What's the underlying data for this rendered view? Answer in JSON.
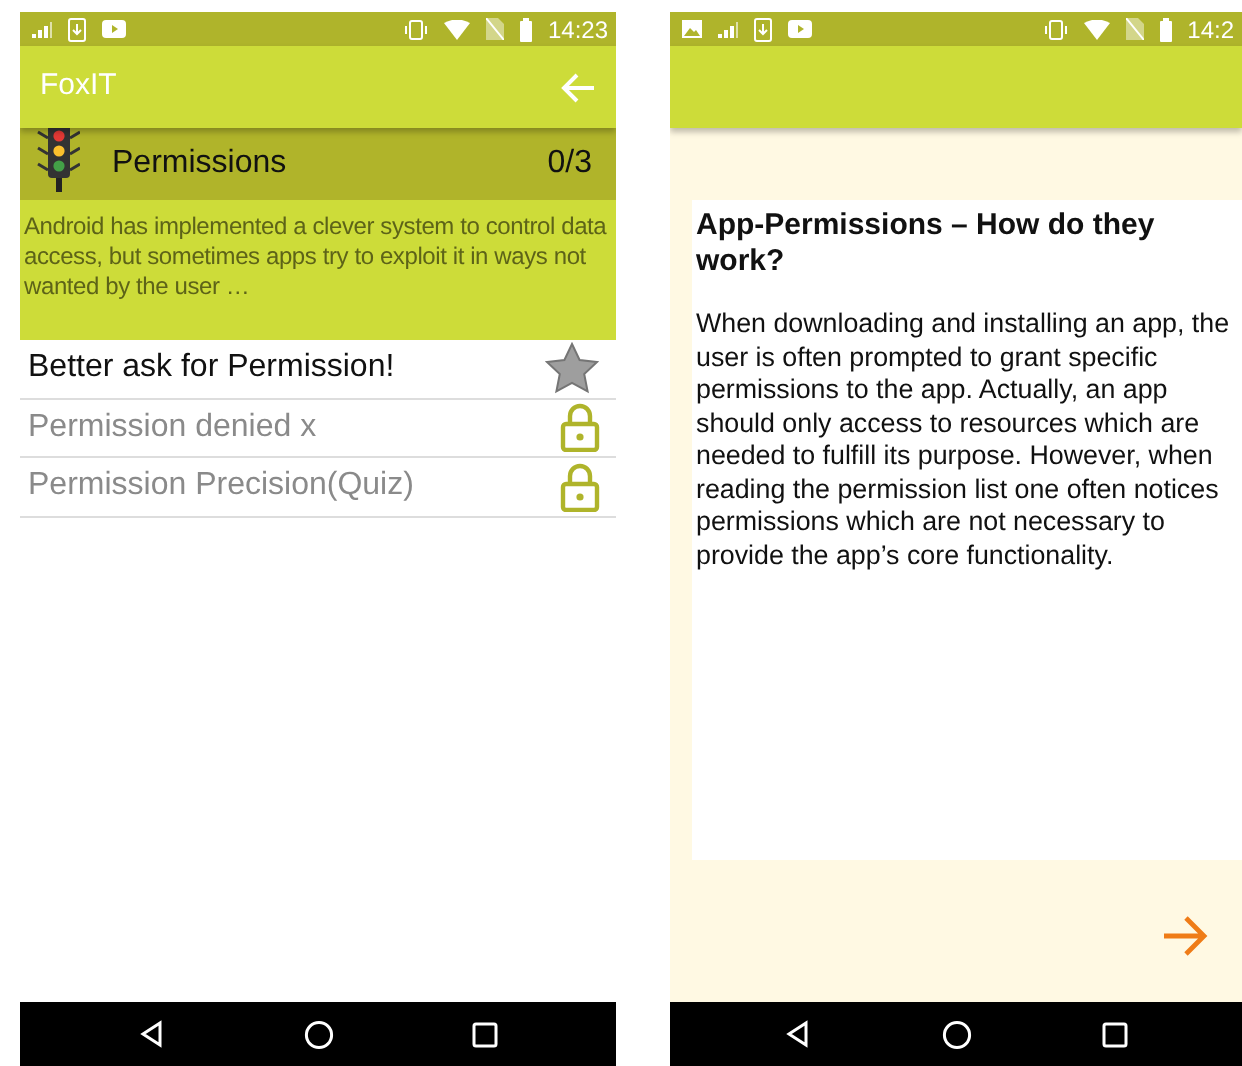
{
  "left_screen": {
    "status_bar": {
      "notifications": [
        {
          "kind": "signal"
        },
        {
          "kind": "download"
        },
        {
          "kind": "video"
        }
      ],
      "system": [
        {
          "kind": "vibrate"
        },
        {
          "kind": "wifi"
        },
        {
          "kind": "nosim"
        },
        {
          "kind": "battery"
        }
      ],
      "time": "14:23"
    },
    "app_bar": {
      "title": "FoxIT"
    },
    "module": {
      "title": "Permissions",
      "progress": "0/3",
      "description": "Android has implemented a clever system to control data access, but sometimes apps try to exploit it in ways not wanted by the user …"
    },
    "lessons": [
      {
        "title": "Better ask for Permission!",
        "locked": false
      },
      {
        "title": "Permission denied x",
        "locked": true
      },
      {
        "title": "Permission Precision(Quiz)",
        "locked": true
      }
    ]
  },
  "right_screen": {
    "status_bar": {
      "notifications": [
        {
          "kind": "image"
        },
        {
          "kind": "signal"
        },
        {
          "kind": "download"
        },
        {
          "kind": "video"
        }
      ],
      "system": [
        {
          "kind": "vibrate"
        },
        {
          "kind": "wifi"
        },
        {
          "kind": "nosim"
        },
        {
          "kind": "battery"
        }
      ],
      "time": "14:2"
    },
    "article": {
      "title": "App-Permissions – How do they work?",
      "body": "When downloading and installing an app, the user is often prompted to grant specific permissions to the app. Actually, an app should only access to resources which are needed to fulfill its purpose. However, when reading the permission list one often notices permissions which are not necessary to provide the app’s core functionality."
    }
  }
}
